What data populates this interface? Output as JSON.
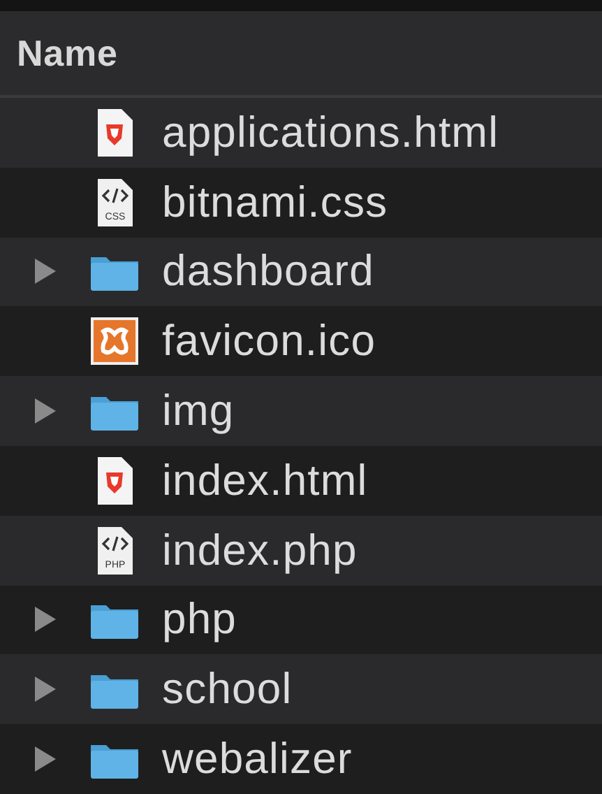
{
  "header": {
    "column": "Name"
  },
  "rows": [
    {
      "name": "applications.html",
      "kind": "html"
    },
    {
      "name": "bitnami.css",
      "kind": "code",
      "icon_label": "CSS"
    },
    {
      "name": "dashboard",
      "kind": "folder",
      "expanded": false
    },
    {
      "name": "favicon.ico",
      "kind": "xampp"
    },
    {
      "name": "img",
      "kind": "folder",
      "expanded": false
    },
    {
      "name": "index.html",
      "kind": "html"
    },
    {
      "name": "index.php",
      "kind": "code",
      "icon_label": "PHP"
    },
    {
      "name": "php",
      "kind": "folder",
      "expanded": false
    },
    {
      "name": "school",
      "kind": "folder",
      "expanded": false
    },
    {
      "name": "webalizer",
      "kind": "folder",
      "expanded": false
    }
  ]
}
